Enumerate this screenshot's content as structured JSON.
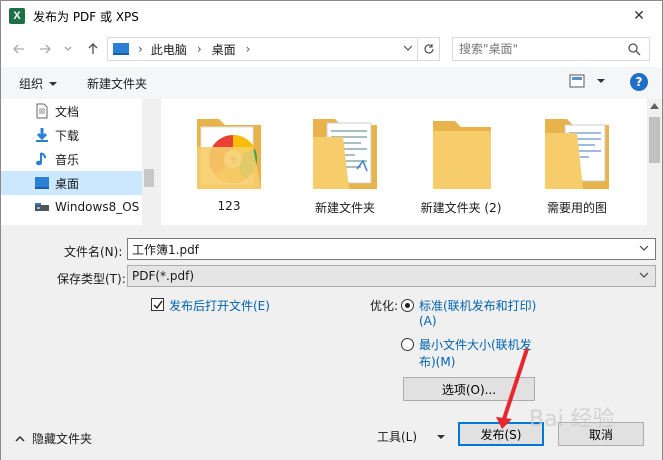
{
  "window": {
    "title": "发布为 PDF 或 XPS",
    "app_icon_letter": "X",
    "close_glyph": "✕"
  },
  "address": {
    "path": [
      "此电脑",
      "桌面"
    ],
    "search_placeholder": "搜索\"桌面\""
  },
  "toolbar": {
    "organize_label": "组织",
    "new_folder_label": "新建文件夹"
  },
  "nav": {
    "items": [
      {
        "label": "文档",
        "icon": "document-icon"
      },
      {
        "label": "下载",
        "icon": "download-icon"
      },
      {
        "label": "音乐",
        "icon": "music-icon"
      },
      {
        "label": "桌面",
        "icon": "desktop-icon",
        "selected": true
      },
      {
        "label": "Windows8_OS",
        "icon": "drive-icon"
      }
    ]
  },
  "files": [
    {
      "label": "123"
    },
    {
      "label": "新建文件夹"
    },
    {
      "label": "新建文件夹 (2)"
    },
    {
      "label": "需要用的图"
    }
  ],
  "form": {
    "filename_label": "文件名(N):",
    "filename_value": "工作簿1.pdf",
    "filetype_label": "保存类型(T):",
    "filetype_value": "PDF(*.pdf)",
    "open_after_label": "发布后打开文件(E)",
    "open_after_checked": true,
    "optimize_label": "优化:",
    "opt_standard_line1": "标准(联机发布和打印)",
    "opt_standard_line2": "(A)",
    "opt_min_line1": "最小文件大小(联机发",
    "opt_min_line2": "布)(M)",
    "options_button": "选项(O)...",
    "hide_folders_label": "隐藏文件夹",
    "tools_label": "工具(L)",
    "publish_button": "发布(S)",
    "cancel_button": "取消"
  },
  "watermark": "Bai 经验",
  "colors": {
    "accent": "#0078d7",
    "link_blue": "#0063b1",
    "selection": "#cce8ff",
    "arrow_red": "#e8262d",
    "folder_yellow": "#f6cd6a"
  }
}
